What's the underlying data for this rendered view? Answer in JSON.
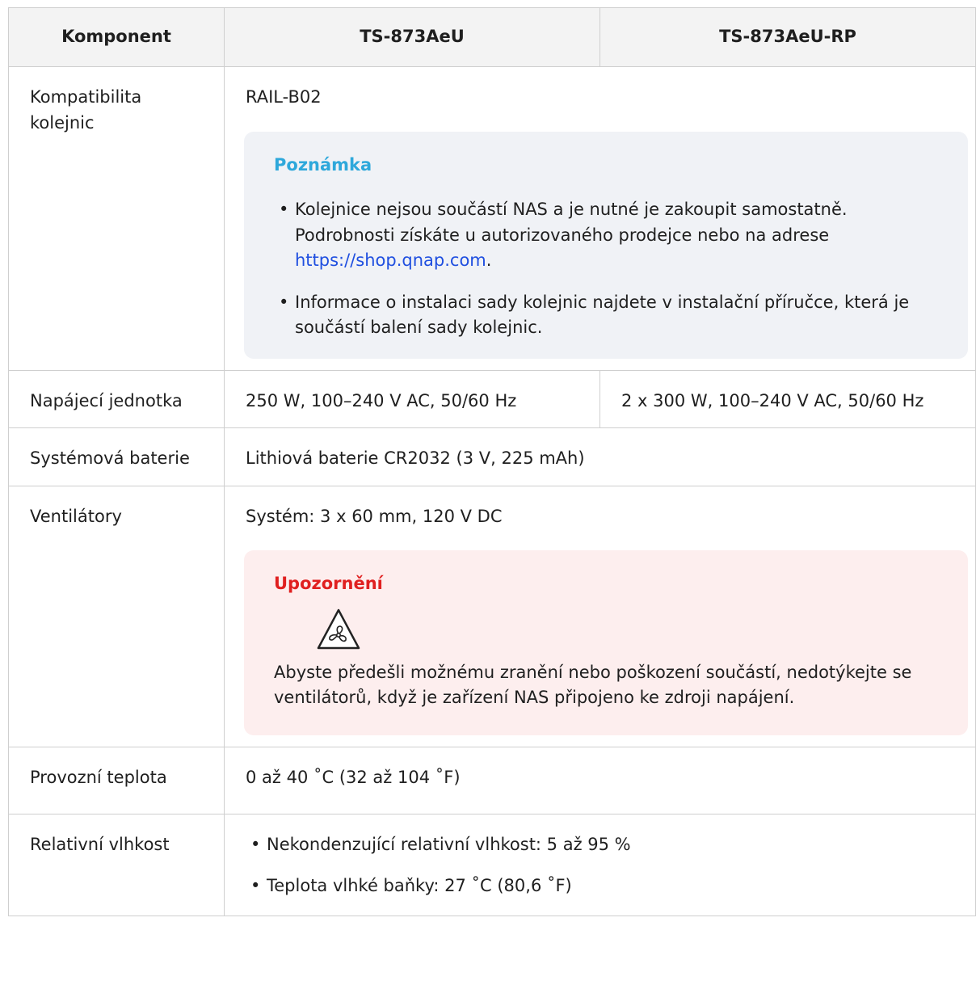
{
  "header": {
    "col1": "Komponent",
    "col2": "TS-873AeU",
    "col3": "TS-873AeU-RP"
  },
  "rails": {
    "label": "Kompatibilita kolejnic",
    "value": "RAIL-B02",
    "note_title": "Poznámka",
    "note_item1_text": "Kolejnice nejsou součástí NAS a je nutné je zakoupit samostatně. Podrobnosti získáte u autorizovaného prodejce nebo na adrese ",
    "note_item1_link": "https://shop.qnap.com",
    "note_item1_end": ".",
    "note_item2": "Informace o instalaci sady kolejnic najdete v instalační příručce, která je součástí balení sady kolejnic."
  },
  "psu": {
    "label": "Napájecí jednotka",
    "value1": "250 W, 100–240 V AC, 50/60 Hz",
    "value2": "2 x 300 W, 100–240 V AC, 50/60 Hz"
  },
  "battery": {
    "label": "Systémová baterie",
    "value": "Lithiová baterie CR2032 (3 V, 225 mAh)"
  },
  "fans": {
    "label": "Ventilátory",
    "value": "Systém: 3 x 60 mm, 120 V DC",
    "warn_title": "Upozornění",
    "icon": "fan-warning-icon",
    "warn_text": "Abyste předešli možnému zranění nebo poškození součástí, nedotýkejte se ventilátorů, když je zařízení NAS připojeno ke zdroji napájení."
  },
  "temp": {
    "label": "Provozní teplota",
    "value": "0 až 40 ˚C (32 až 104 ˚F)"
  },
  "humidity": {
    "label": "Relativní vlhkost",
    "item1": "Nekondenzující relativní vlhkost: 5 až 95 %",
    "item2": "Teplota vlhké baňky: 27 ˚C (80,6 ˚F)"
  },
  "colors": {
    "note_title": "#2ea8db",
    "warn_title": "#e02020",
    "link": "#1f4fe0"
  }
}
